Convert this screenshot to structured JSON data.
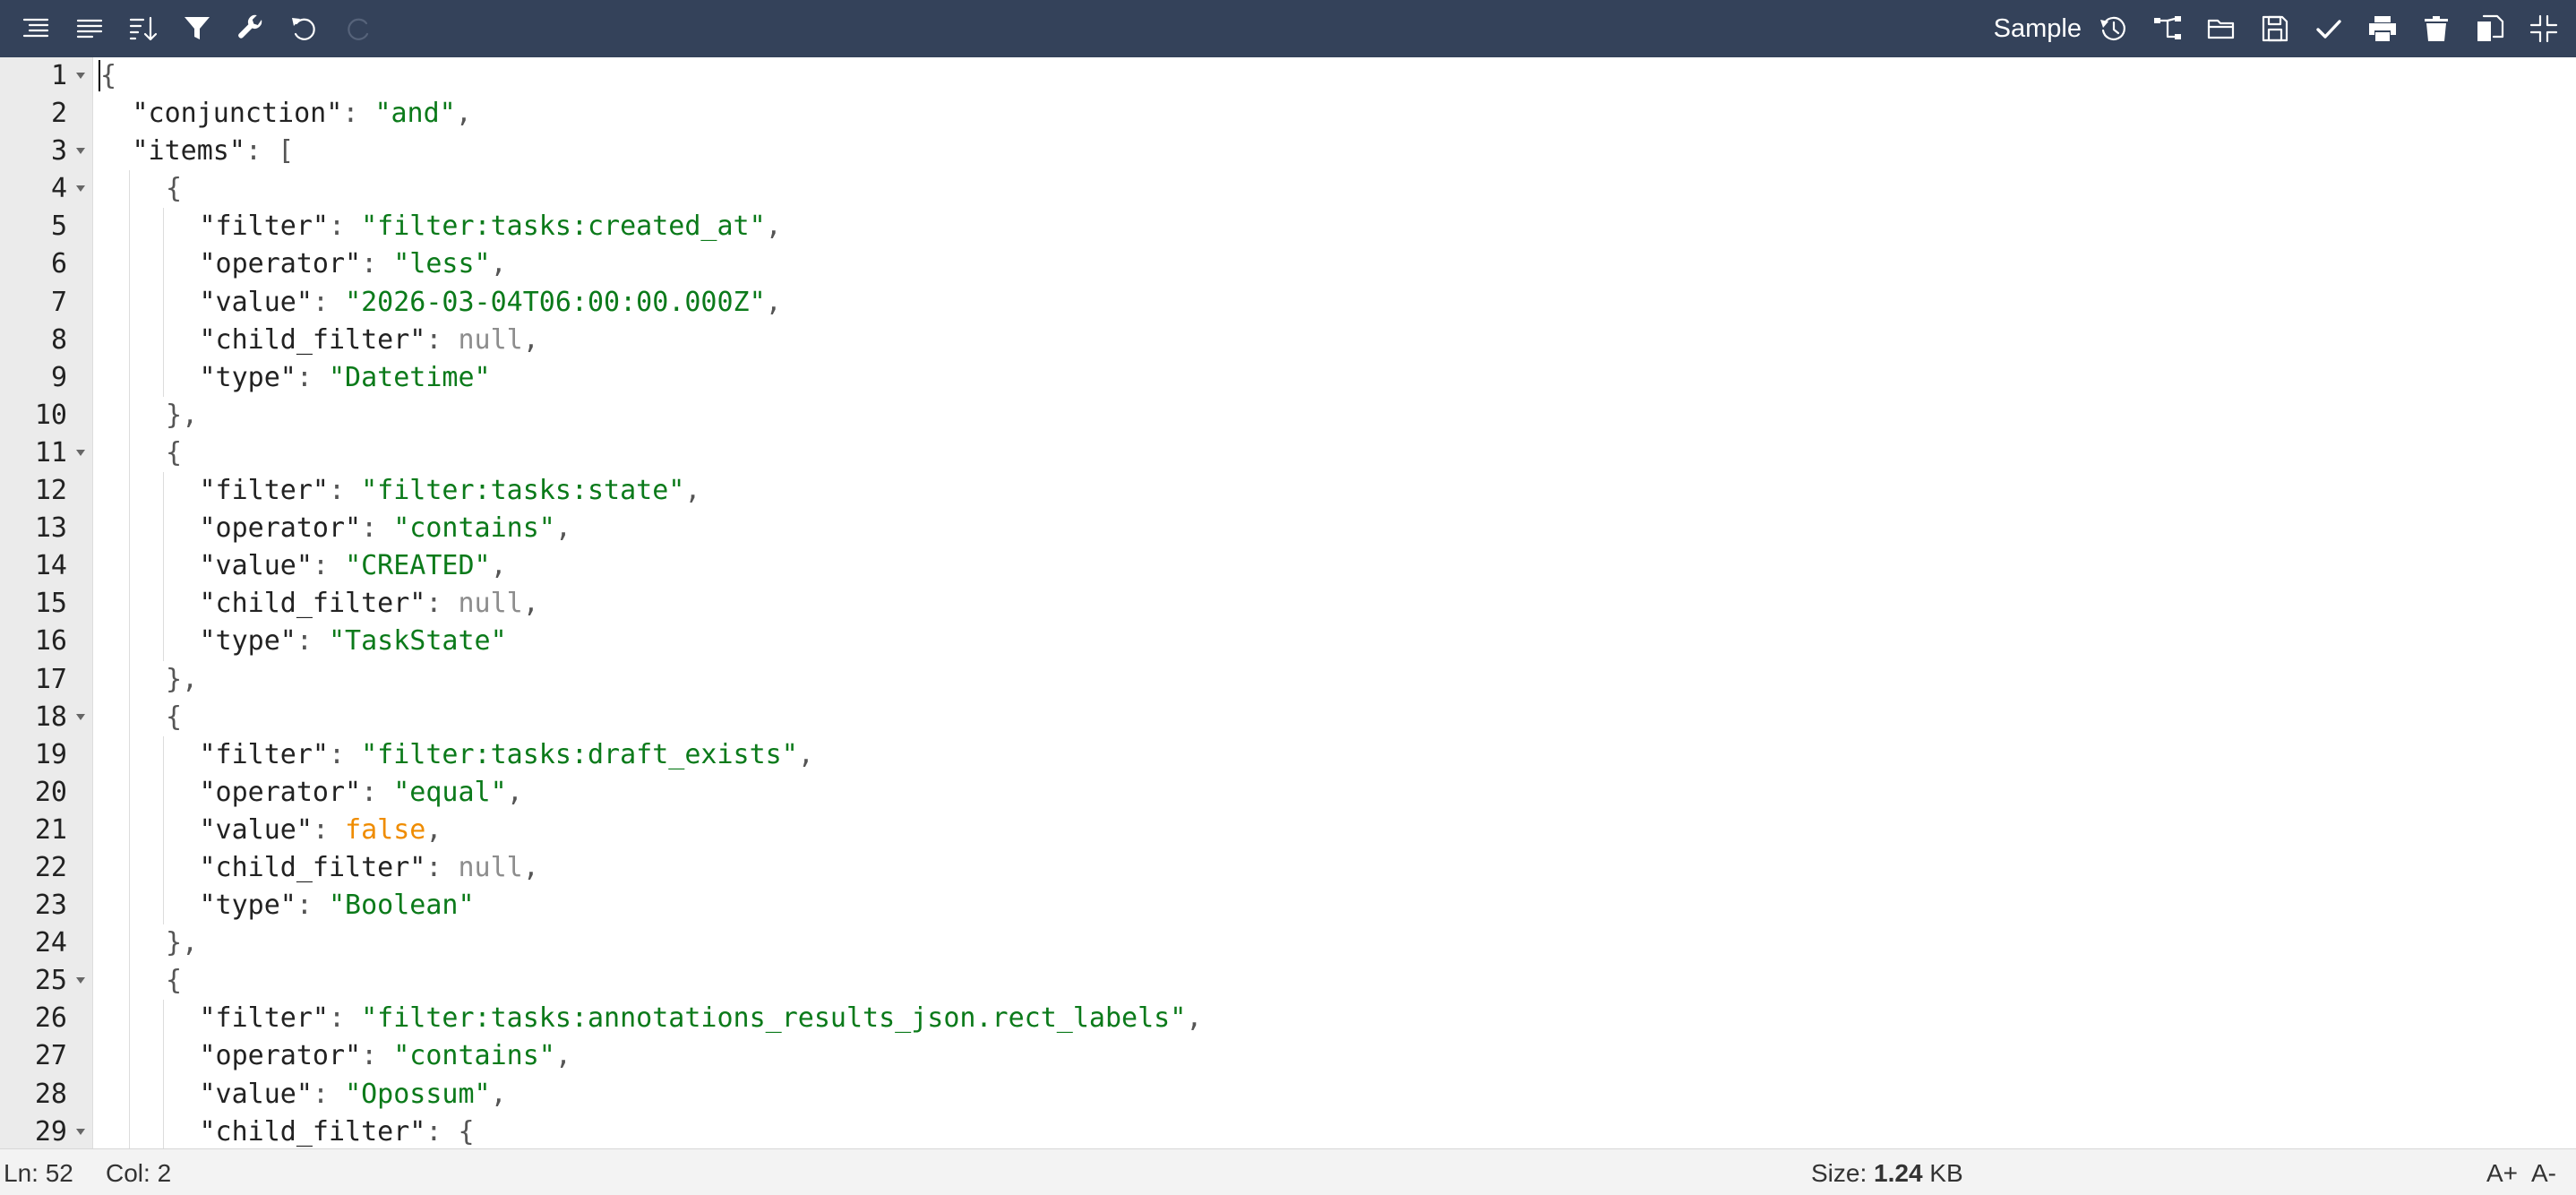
{
  "toolbar": {
    "left_icons": [
      "format-icon",
      "compact-icon",
      "sort-icon",
      "filter-icon",
      "repair-icon",
      "undo-icon",
      "redo-icon"
    ],
    "sample_label": "Sample",
    "right_icons": [
      "history-icon",
      "transform-icon",
      "open-folder-icon",
      "save-icon",
      "validate-icon",
      "print-icon",
      "delete-icon",
      "copy-icon",
      "collapse-icon"
    ]
  },
  "editor": {
    "lines": [
      {
        "n": "1",
        "fold": true,
        "indent": 0,
        "tokens": [
          {
            "t": "{",
            "c": "cursor"
          }
        ]
      },
      {
        "n": "2",
        "fold": false,
        "indent": 1,
        "tokens": [
          {
            "t": "\"conjunction\"",
            "c": "key"
          },
          {
            "t": ": ",
            "c": "punc"
          },
          {
            "t": "\"and\"",
            "c": "str"
          },
          {
            "t": ",",
            "c": "punc"
          }
        ]
      },
      {
        "n": "3",
        "fold": true,
        "indent": 1,
        "tokens": [
          {
            "t": "\"items\"",
            "c": "key"
          },
          {
            "t": ": ",
            "c": "punc"
          },
          {
            "t": "[",
            "c": "brace"
          }
        ]
      },
      {
        "n": "4",
        "fold": true,
        "indent": 2,
        "tokens": [
          {
            "t": "{",
            "c": "brace"
          }
        ]
      },
      {
        "n": "5",
        "fold": false,
        "indent": 3,
        "tokens": [
          {
            "t": "\"filter\"",
            "c": "key"
          },
          {
            "t": ": ",
            "c": "punc"
          },
          {
            "t": "\"filter:tasks:created_at\"",
            "c": "str"
          },
          {
            "t": ",",
            "c": "punc"
          }
        ]
      },
      {
        "n": "6",
        "fold": false,
        "indent": 3,
        "tokens": [
          {
            "t": "\"operator\"",
            "c": "key"
          },
          {
            "t": ": ",
            "c": "punc"
          },
          {
            "t": "\"less\"",
            "c": "str"
          },
          {
            "t": ",",
            "c": "punc"
          }
        ]
      },
      {
        "n": "7",
        "fold": false,
        "indent": 3,
        "tokens": [
          {
            "t": "\"value\"",
            "c": "key"
          },
          {
            "t": ": ",
            "c": "punc"
          },
          {
            "t": "\"2026-03-04T06:00:00.000Z\"",
            "c": "str"
          },
          {
            "t": ",",
            "c": "punc"
          }
        ]
      },
      {
        "n": "8",
        "fold": false,
        "indent": 3,
        "tokens": [
          {
            "t": "\"child_filter\"",
            "c": "key"
          },
          {
            "t": ": ",
            "c": "punc"
          },
          {
            "t": "null",
            "c": "null"
          },
          {
            "t": ",",
            "c": "punc"
          }
        ]
      },
      {
        "n": "9",
        "fold": false,
        "indent": 3,
        "tokens": [
          {
            "t": "\"type\"",
            "c": "key"
          },
          {
            "t": ": ",
            "c": "punc"
          },
          {
            "t": "\"Datetime\"",
            "c": "str"
          }
        ]
      },
      {
        "n": "10",
        "fold": false,
        "indent": 2,
        "tokens": [
          {
            "t": "},",
            "c": "brace"
          }
        ]
      },
      {
        "n": "11",
        "fold": true,
        "indent": 2,
        "tokens": [
          {
            "t": "{",
            "c": "brace"
          }
        ]
      },
      {
        "n": "12",
        "fold": false,
        "indent": 3,
        "tokens": [
          {
            "t": "\"filter\"",
            "c": "key"
          },
          {
            "t": ": ",
            "c": "punc"
          },
          {
            "t": "\"filter:tasks:state\"",
            "c": "str"
          },
          {
            "t": ",",
            "c": "punc"
          }
        ]
      },
      {
        "n": "13",
        "fold": false,
        "indent": 3,
        "tokens": [
          {
            "t": "\"operator\"",
            "c": "key"
          },
          {
            "t": ": ",
            "c": "punc"
          },
          {
            "t": "\"contains\"",
            "c": "str"
          },
          {
            "t": ",",
            "c": "punc"
          }
        ]
      },
      {
        "n": "14",
        "fold": false,
        "indent": 3,
        "tokens": [
          {
            "t": "\"value\"",
            "c": "key"
          },
          {
            "t": ": ",
            "c": "punc"
          },
          {
            "t": "\"CREATED\"",
            "c": "str"
          },
          {
            "t": ",",
            "c": "punc"
          }
        ]
      },
      {
        "n": "15",
        "fold": false,
        "indent": 3,
        "tokens": [
          {
            "t": "\"child_filter\"",
            "c": "key"
          },
          {
            "t": ": ",
            "c": "punc"
          },
          {
            "t": "null",
            "c": "null"
          },
          {
            "t": ",",
            "c": "punc"
          }
        ]
      },
      {
        "n": "16",
        "fold": false,
        "indent": 3,
        "tokens": [
          {
            "t": "\"type\"",
            "c": "key"
          },
          {
            "t": ": ",
            "c": "punc"
          },
          {
            "t": "\"TaskState\"",
            "c": "str"
          }
        ]
      },
      {
        "n": "17",
        "fold": false,
        "indent": 2,
        "tokens": [
          {
            "t": "},",
            "c": "brace"
          }
        ]
      },
      {
        "n": "18",
        "fold": true,
        "indent": 2,
        "tokens": [
          {
            "t": "{",
            "c": "brace"
          }
        ]
      },
      {
        "n": "19",
        "fold": false,
        "indent": 3,
        "tokens": [
          {
            "t": "\"filter\"",
            "c": "key"
          },
          {
            "t": ": ",
            "c": "punc"
          },
          {
            "t": "\"filter:tasks:draft_exists\"",
            "c": "str"
          },
          {
            "t": ",",
            "c": "punc"
          }
        ]
      },
      {
        "n": "20",
        "fold": false,
        "indent": 3,
        "tokens": [
          {
            "t": "\"operator\"",
            "c": "key"
          },
          {
            "t": ": ",
            "c": "punc"
          },
          {
            "t": "\"equal\"",
            "c": "str"
          },
          {
            "t": ",",
            "c": "punc"
          }
        ]
      },
      {
        "n": "21",
        "fold": false,
        "indent": 3,
        "tokens": [
          {
            "t": "\"value\"",
            "c": "key"
          },
          {
            "t": ": ",
            "c": "punc"
          },
          {
            "t": "false",
            "c": "bool"
          },
          {
            "t": ",",
            "c": "punc"
          }
        ]
      },
      {
        "n": "22",
        "fold": false,
        "indent": 3,
        "tokens": [
          {
            "t": "\"child_filter\"",
            "c": "key"
          },
          {
            "t": ": ",
            "c": "punc"
          },
          {
            "t": "null",
            "c": "null"
          },
          {
            "t": ",",
            "c": "punc"
          }
        ]
      },
      {
        "n": "23",
        "fold": false,
        "indent": 3,
        "tokens": [
          {
            "t": "\"type\"",
            "c": "key"
          },
          {
            "t": ": ",
            "c": "punc"
          },
          {
            "t": "\"Boolean\"",
            "c": "str"
          }
        ]
      },
      {
        "n": "24",
        "fold": false,
        "indent": 2,
        "tokens": [
          {
            "t": "},",
            "c": "brace"
          }
        ]
      },
      {
        "n": "25",
        "fold": true,
        "indent": 2,
        "tokens": [
          {
            "t": "{",
            "c": "brace"
          }
        ]
      },
      {
        "n": "26",
        "fold": false,
        "indent": 3,
        "tokens": [
          {
            "t": "\"filter\"",
            "c": "key"
          },
          {
            "t": ": ",
            "c": "punc"
          },
          {
            "t": "\"filter:tasks:annotations_results_json.rect_labels\"",
            "c": "str"
          },
          {
            "t": ",",
            "c": "punc"
          }
        ]
      },
      {
        "n": "27",
        "fold": false,
        "indent": 3,
        "tokens": [
          {
            "t": "\"operator\"",
            "c": "key"
          },
          {
            "t": ": ",
            "c": "punc"
          },
          {
            "t": "\"contains\"",
            "c": "str"
          },
          {
            "t": ",",
            "c": "punc"
          }
        ]
      },
      {
        "n": "28",
        "fold": false,
        "indent": 3,
        "tokens": [
          {
            "t": "\"value\"",
            "c": "key"
          },
          {
            "t": ": ",
            "c": "punc"
          },
          {
            "t": "\"Opossum\"",
            "c": "str"
          },
          {
            "t": ",",
            "c": "punc"
          }
        ]
      },
      {
        "n": "29",
        "fold": true,
        "indent": 3,
        "tokens": [
          {
            "t": "\"child_filter\"",
            "c": "key"
          },
          {
            "t": ": ",
            "c": "punc"
          },
          {
            "t": "{",
            "c": "brace"
          }
        ]
      }
    ]
  },
  "status": {
    "ln": "Ln: 52",
    "col": "Col: 2",
    "size_label": "Size: ",
    "size_value": "1.24",
    "size_unit": " KB",
    "font_up": "A+",
    "font_down": "A-"
  },
  "colors": {
    "toolbar_bg": "#34425a",
    "string": "#0b7a1a",
    "null": "#8d8d8d",
    "boolean": "#ef8c00",
    "gutter_bg": "#ebebeb"
  }
}
